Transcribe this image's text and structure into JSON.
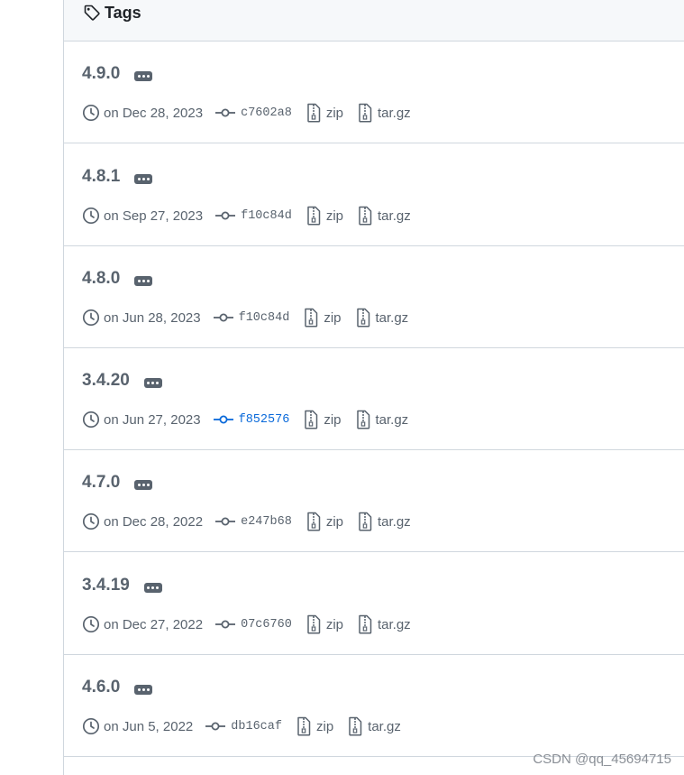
{
  "header": {
    "title": "Tags",
    "icon": "tag-icon"
  },
  "colors": {
    "border": "#d0d7de",
    "muted": "#59636e",
    "accent": "#0969da",
    "header_bg": "#f6f8fa"
  },
  "tags": [
    {
      "name": "4.9.0",
      "date": "on Dec 28, 2023",
      "sha": "c7602a8",
      "zip": "zip",
      "targz": "tar.gz",
      "highlight": false
    },
    {
      "name": "4.8.1",
      "date": "on Sep 27, 2023",
      "sha": "f10c84d",
      "zip": "zip",
      "targz": "tar.gz",
      "highlight": false
    },
    {
      "name": "4.8.0",
      "date": "on Jun 28, 2023",
      "sha": "f10c84d",
      "zip": "zip",
      "targz": "tar.gz",
      "highlight": false
    },
    {
      "name": "3.4.20",
      "date": "on Jun 27, 2023",
      "sha": "f852576",
      "zip": "zip",
      "targz": "tar.gz",
      "highlight": true
    },
    {
      "name": "4.7.0",
      "date": "on Dec 28, 2022",
      "sha": "e247b68",
      "zip": "zip",
      "targz": "tar.gz",
      "highlight": false
    },
    {
      "name": "3.4.19",
      "date": "on Dec 27, 2022",
      "sha": "07c6760",
      "zip": "zip",
      "targz": "tar.gz",
      "highlight": false
    },
    {
      "name": "4.6.0",
      "date": "on Jun 5, 2022",
      "sha": "db16caf",
      "zip": "zip",
      "targz": "tar.gz",
      "highlight": false
    }
  ],
  "watermark": "CSDN @qq_45694715"
}
